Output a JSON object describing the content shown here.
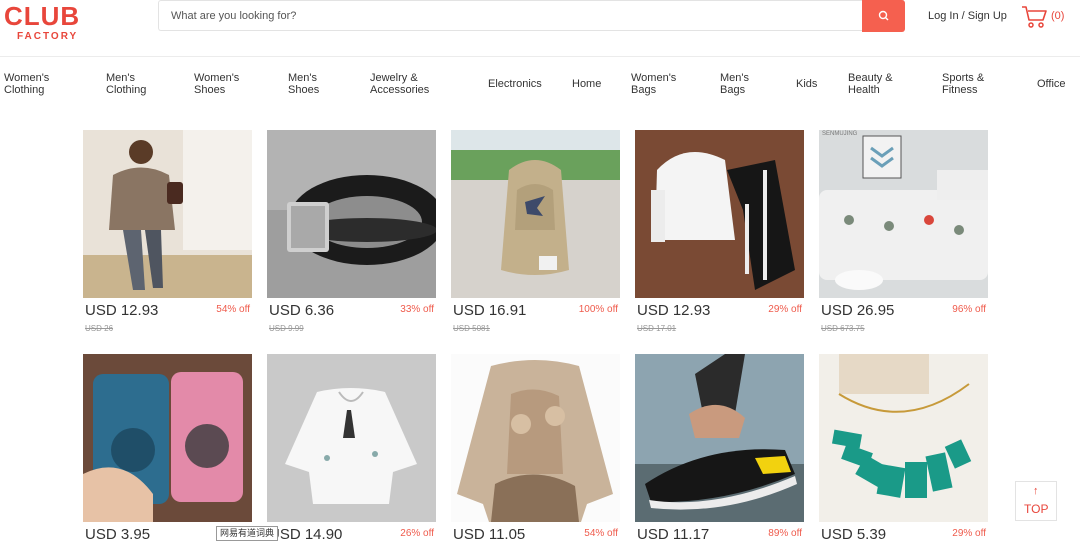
{
  "brand": {
    "name": "CLUB",
    "sub": "FACTORY",
    "color": "#e8463b"
  },
  "search": {
    "placeholder": "What are you looking for?",
    "icon": "search-icon",
    "button_color": "#f5604f"
  },
  "account": {
    "login_label": "Log In / Sign Up",
    "cart_icon": "cart-icon",
    "cart_count": "(0)"
  },
  "nav": [
    "Women's\nClothing",
    "Men's\nClothing",
    "Women's\nShoes",
    "Men's\nShoes",
    "Jewelry &\nAccessories",
    "Electronics",
    "Home",
    "Women's\nBags",
    "Men's\nBags",
    "Kids",
    "Beauty &\nHealth",
    "Sports &\nFitness",
    "Office"
  ],
  "products": [
    {
      "price": "USD 12.93",
      "discount": "54% off",
      "original": "USD 26",
      "image": "woman in sweater"
    },
    {
      "price": "USD 6.36",
      "discount": "33% off",
      "original": "USD 9.99",
      "image": "black leather bracelet"
    },
    {
      "price": "USD 16.91",
      "discount": "100% off",
      "original": "USD 5081",
      "image": "canvas backpack"
    },
    {
      "price": "USD 12.93",
      "discount": "29% off",
      "original": "USD 17.01",
      "image": "hoodie tracksuit"
    },
    {
      "price": "USD 26.95",
      "discount": "96% off",
      "original": "USD 673.75",
      "image": "sofa cover",
      "watermark": "SENMUJING"
    },
    {
      "price": "USD 3.95",
      "discount": "",
      "original": "",
      "image": "phone cases"
    },
    {
      "price": "USD 14.90",
      "discount": "26% off",
      "original": "",
      "image": "white blouse"
    },
    {
      "price": "USD 11.05",
      "discount": "54% off",
      "original": "",
      "image": "art print sweatshirt"
    },
    {
      "price": "USD 11.17",
      "discount": "89% off",
      "original": "",
      "image": "black sneakers"
    },
    {
      "price": "USD 5.39",
      "discount": "29% off",
      "original": "",
      "image": "turquoise necklace"
    }
  ],
  "tooltip": "网易有道词典",
  "top_button": {
    "arrow": "↑",
    "label": "TOP"
  }
}
